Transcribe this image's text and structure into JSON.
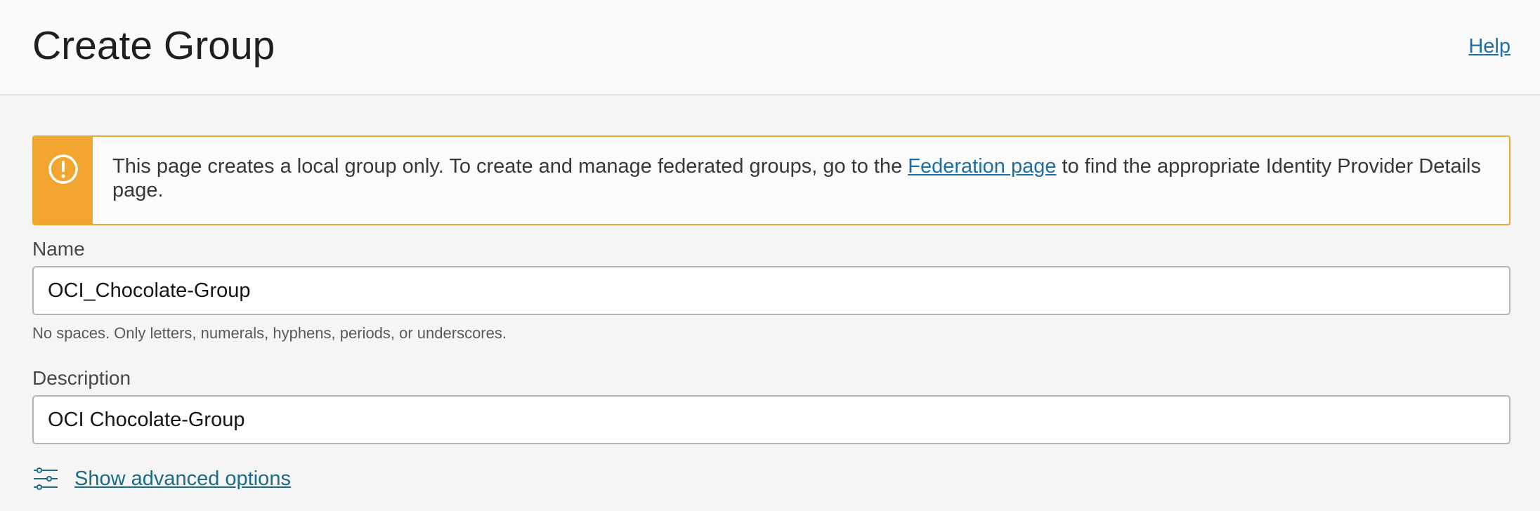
{
  "header": {
    "title": "Create Group",
    "help_label": "Help"
  },
  "alert": {
    "text_before": "This page creates a local group only. To create and manage federated groups, go to the ",
    "link_label": "Federation page",
    "text_after": " to find the appropriate Identity Provider Details page.",
    "icon": "exclamation-circle-icon",
    "accent_color": "#f2a630"
  },
  "form": {
    "name": {
      "label": "Name",
      "value": "OCI_Chocolate-Group",
      "hint": "No spaces. Only letters, numerals, hyphens, periods, or underscores."
    },
    "description": {
      "label": "Description",
      "value": "OCI Chocolate-Group"
    },
    "advanced": {
      "label": "Show advanced options",
      "icon": "sliders-icon"
    }
  },
  "colors": {
    "link": "#1e6fa8",
    "advanced_link": "#1c6b84",
    "warning": "#f2a630"
  }
}
